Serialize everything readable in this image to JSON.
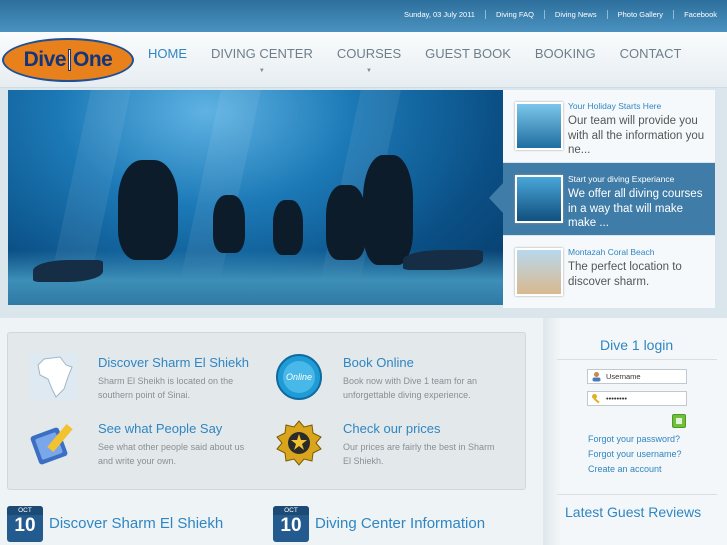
{
  "topbar": {
    "date": "Sunday, 03 July 2011",
    "links": [
      "Diving FAQ",
      "Diving News",
      "Photo Gallery",
      "Facebook"
    ]
  },
  "logo": {
    "left": "Dive",
    "right": "One"
  },
  "nav": [
    "HOME",
    "DIVING CENTER",
    "COURSES",
    "GUEST BOOK",
    "BOOKING",
    "CONTACT"
  ],
  "slides": [
    {
      "title": "Your Holiday Starts Here",
      "text": "Our team will provide you with all the information you ne..."
    },
    {
      "title": "Start your diving Experiance",
      "text": "We offer all diving courses in a way that will make make ..."
    },
    {
      "title": "Montazah Coral Beach",
      "text": "The perfect location to discover sharm."
    }
  ],
  "features": [
    {
      "title": "Discover Sharm El Shiekh",
      "text": "Sharm El Sheikh is located on the southern point of Sinai."
    },
    {
      "title": "Book Online",
      "text": "Book now with Dive 1 team for an unforgettable diving experience.",
      "badge": "Online"
    },
    {
      "title": "See what People Say",
      "text": "See what other people said about us and write your own."
    },
    {
      "title": "Check our prices",
      "text": "Our prices are fairly the best in Sharm El Shiekh."
    }
  ],
  "news": [
    {
      "month": "OCT",
      "day": "10",
      "title": "Discover Sharm El Shiekh"
    },
    {
      "month": "OCT",
      "day": "10",
      "title": "Diving Center Information"
    }
  ],
  "login": {
    "title": "Dive 1 login",
    "username_placeholder": "Username",
    "password_value": "••••••••",
    "forgot_password": "Forgot your password?",
    "forgot_username": "Forgot your username?",
    "create_account": "Create an account"
  },
  "reviews_title": "Latest Guest Reviews"
}
